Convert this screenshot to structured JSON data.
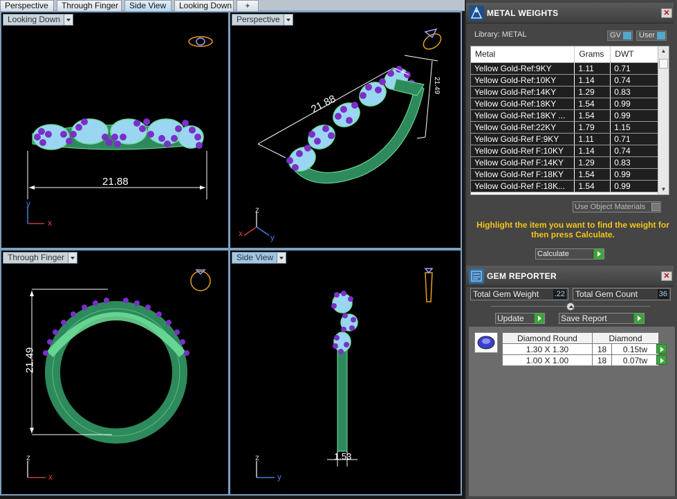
{
  "tabs": [
    {
      "label": "Perspective",
      "active": false
    },
    {
      "label": "Through Finger",
      "active": false
    },
    {
      "label": "Side View",
      "active": true
    },
    {
      "label": "Looking Down",
      "active": false
    },
    {
      "label": "+",
      "active": false
    }
  ],
  "viewports": {
    "looking_down": {
      "label": "Looking Down",
      "dimension": "21.88",
      "axis_v": "y",
      "axis_h": "x"
    },
    "perspective": {
      "label": "Perspective",
      "dimension_main": "21.88",
      "dimension_side": "21.49",
      "axis_z": "z",
      "axis_x": "x",
      "axis_y": "y"
    },
    "through_finger": {
      "label": "Through Finger",
      "dimension": "21.49",
      "axis_v": "z",
      "axis_h": "x"
    },
    "side_view": {
      "label": "Side View",
      "dimension": "1.53",
      "axis_v": "z",
      "axis_h": "y"
    }
  },
  "metal_weights": {
    "title": "METAL WEIGHTS",
    "library": "Library: METAL",
    "toggle_gv": "GV",
    "toggle_user": "User",
    "columns": [
      "Metal",
      "Grams",
      "DWT"
    ],
    "rows": [
      [
        "Yellow Gold-Ref:9KY",
        "1.11",
        "0.71"
      ],
      [
        "Yellow Gold-Ref:10KY",
        "1.14",
        "0.74"
      ],
      [
        "Yellow Gold-Ref:14KY",
        "1.29",
        "0.83"
      ],
      [
        "Yellow Gold-Ref:18KY",
        "1.54",
        "0.99"
      ],
      [
        "Yellow Gold-Ref:18KY ...",
        "1.54",
        "0.99"
      ],
      [
        "Yellow Gold-Ref:22KY",
        "1.79",
        "1.15"
      ],
      [
        "Yellow Gold-Ref F:9KY",
        "1.11",
        "0.71"
      ],
      [
        "Yellow Gold-Ref F:10KY",
        "1.14",
        "0.74"
      ],
      [
        "Yellow Gold-Ref F:14KY",
        "1.29",
        "0.83"
      ],
      [
        "Yellow Gold-Ref F:18KY",
        "1.54",
        "0.99"
      ],
      [
        "Yellow Gold-Ref F:18K...",
        "1.54",
        "0.99"
      ]
    ],
    "use_object_materials": "Use Object Materials",
    "hint": "Highlight the item you want to find the weight for then press Calculate.",
    "calculate": "Calculate"
  },
  "gem_reporter": {
    "title": "GEM REPORTER",
    "total_weight_label": "Total Gem Weight",
    "total_weight_value": ".22",
    "total_count_label": "Total Gem Count",
    "total_count_value": "36",
    "update": "Update",
    "save_report": "Save Report",
    "header": [
      "Diamond Round",
      "Diamond"
    ],
    "rows": [
      [
        "1.30 X 1.30",
        "18",
        "0.15tw"
      ],
      [
        "1.00 X 1.00",
        "18",
        "0.07tw"
      ]
    ]
  }
}
